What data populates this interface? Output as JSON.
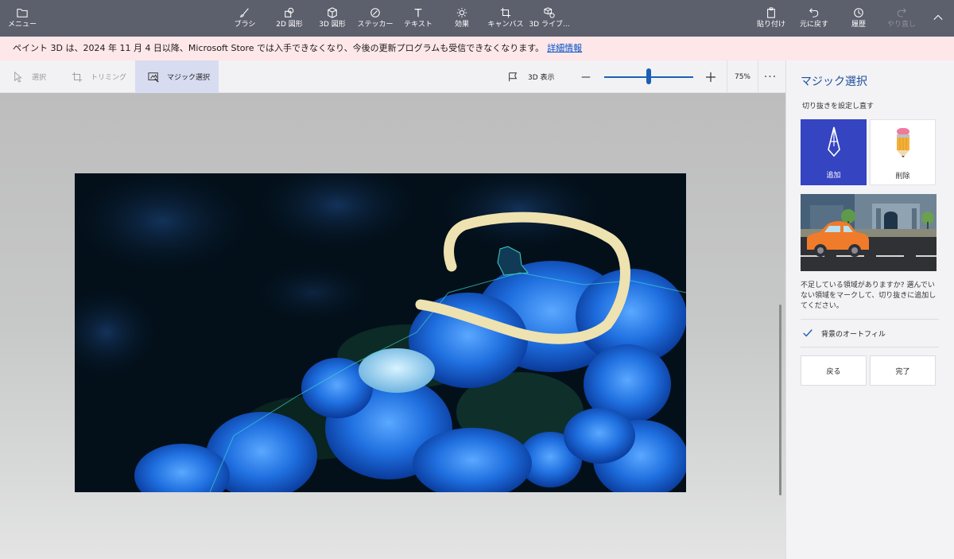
{
  "toolbar": {
    "menu": "メニュー",
    "brush": "ブラシ",
    "shapes2d": "2D 図形",
    "shapes3d": "3D 図形",
    "stickers": "ステッカー",
    "text": "テキスト",
    "effects": "効果",
    "canvas": "キャンバス",
    "library3d": "3D ライブ...",
    "paste": "貼り付け",
    "undo": "元に戻す",
    "history": "履歴",
    "redo": "やり直し"
  },
  "notice": {
    "message": "ペイント 3D は、2024 年 11 月 4 日以降、Microsoft Store では入手できなくなり、今後の更新プログラムも受信できなくなります。",
    "link": "詳細情報"
  },
  "subtoolbar": {
    "select": "選択",
    "crop": "トリミング",
    "magic_select": "マジック選択",
    "view3d": "3D 表示",
    "zoom_level": 0.5,
    "zoom_label": "75%",
    "more": "···"
  },
  "panel": {
    "title": "マジック選択",
    "reset_label": "切り抜きを設定し直す",
    "add": "追加",
    "remove": "削除",
    "hint": "不足している領域がありますか? 選んでいない領域をマークして、切り抜きに追加してください。",
    "autofill": "背景のオートフィル",
    "autofill_checked": true,
    "back": "戻る",
    "done": "完了"
  },
  "colors": {
    "titlebar": "#5c5f6c",
    "accent": "#3544c0",
    "notice_bg": "#fde7e9",
    "stroke": "#eee2b0"
  }
}
